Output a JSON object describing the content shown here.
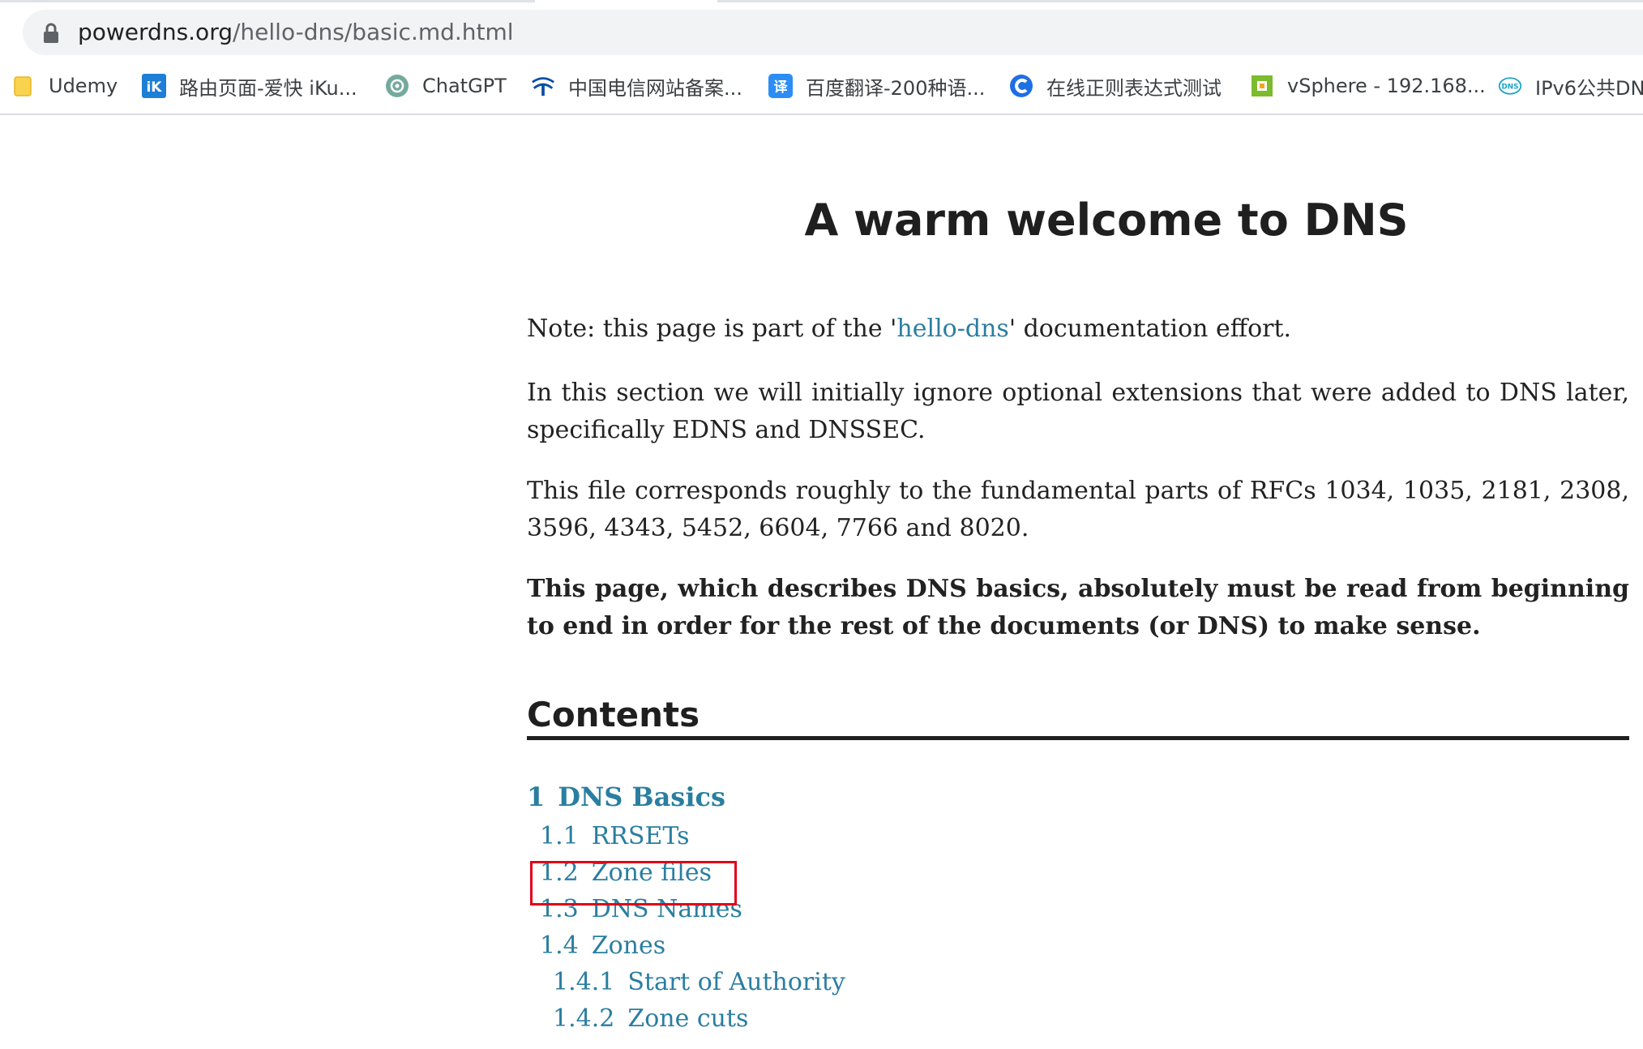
{
  "browser": {
    "url_host": "powerdns.org",
    "url_path": "/hello-dns/basic.md.html"
  },
  "bookmarks": [
    {
      "label": "Udemy",
      "icon": "folder-icon"
    },
    {
      "label": "路由页面-爱快 iKu...",
      "icon": "ikuai-icon"
    },
    {
      "label": "ChatGPT",
      "icon": "chatgpt-icon"
    },
    {
      "label": "中国电信网站备案...",
      "icon": "china-telecom-icon"
    },
    {
      "label": "百度翻译-200种语...",
      "icon": "baidu-translate-icon"
    },
    {
      "label": "在线正则表达式测试",
      "icon": "regex-tester-icon"
    },
    {
      "label": "vSphere - 192.168...",
      "icon": "vsphere-icon"
    },
    {
      "label": "IPv6公共DN",
      "icon": "dns-icon"
    }
  ],
  "page": {
    "title": "A warm welcome to DNS",
    "note_before": "Note: this page is part of the '",
    "note_link": "hello-dns",
    "note_after": "' documentation effort.",
    "para2": "In this section we will initially ignore optional extensions that were added to DNS later, specifically EDNS and DNSSEC.",
    "para3": "This file corresponds roughly to the fundamental parts of RFCs 1034, 1035, 2181, 2308, 3596, 4343, 5452, 6604, 7766 and 8020.",
    "para4": "This page, which describes DNS basics, absolutely must be read from beginning to end in order for the rest of the documents (or DNS) to make sense.",
    "contents_heading": "Contents"
  },
  "toc": [
    {
      "num": "1",
      "label": "DNS Basics",
      "level": 1
    },
    {
      "num": "1.1",
      "label": "RRSETs",
      "level": 2
    },
    {
      "num": "1.2",
      "label": "Zone files",
      "level": 2,
      "highlighted": true
    },
    {
      "num": "1.3",
      "label": "DNS Names",
      "level": 2
    },
    {
      "num": "1.4",
      "label": "Zones",
      "level": 2
    },
    {
      "num": "1.4.1",
      "label": "Start of Authority",
      "level": 3
    },
    {
      "num": "1.4.2",
      "label": "Zone cuts",
      "level": 3
    }
  ],
  "colors": {
    "link": "#2a7ea0",
    "highlight_box": "#e2001a",
    "text": "#222222"
  }
}
